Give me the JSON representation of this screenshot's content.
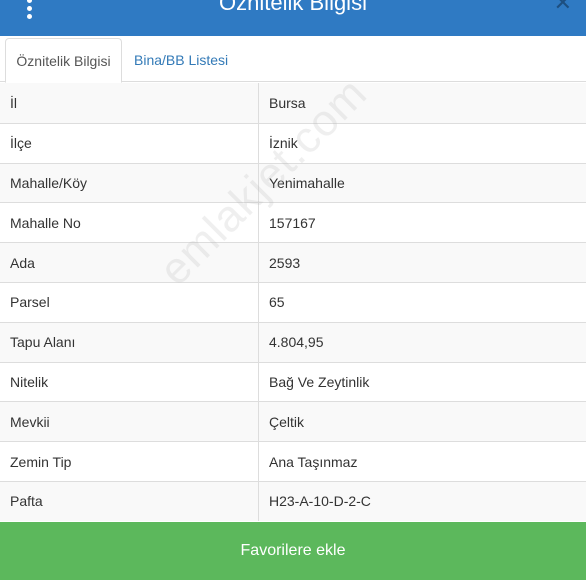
{
  "header": {
    "title": "Öznitelik Bilgisi",
    "close_symbol": "✕",
    "menu_icon": "kebab-menu-icon",
    "background_color": "#2f7ac3"
  },
  "tabs": [
    {
      "label": "Öznitelik Bilgisi",
      "active": true
    },
    {
      "label": "Bina/BB Listesi",
      "active": false
    }
  ],
  "rows": [
    {
      "label": "İl",
      "value": "Bursa"
    },
    {
      "label": "İlçe",
      "value": "İznik"
    },
    {
      "label": "Mahalle/Köy",
      "value": "Yenimahalle"
    },
    {
      "label": "Mahalle No",
      "value": "157167"
    },
    {
      "label": "Ada",
      "value": "2593"
    },
    {
      "label": "Parsel",
      "value": "65"
    },
    {
      "label": "Tapu Alanı",
      "value": "4.804,95"
    },
    {
      "label": "Nitelik",
      "value": "Bağ Ve Zeytinlik"
    },
    {
      "label": "Mevkii",
      "value": "Çeltik"
    },
    {
      "label": "Zemin Tip",
      "value": "Ana Taşınmaz"
    },
    {
      "label": "Pafta",
      "value": "H23-A-10-D-2-C"
    }
  ],
  "watermark": "emlakjet.com",
  "footer": {
    "button_label": "Favorilere ekle",
    "button_color": "#5cb85c"
  }
}
